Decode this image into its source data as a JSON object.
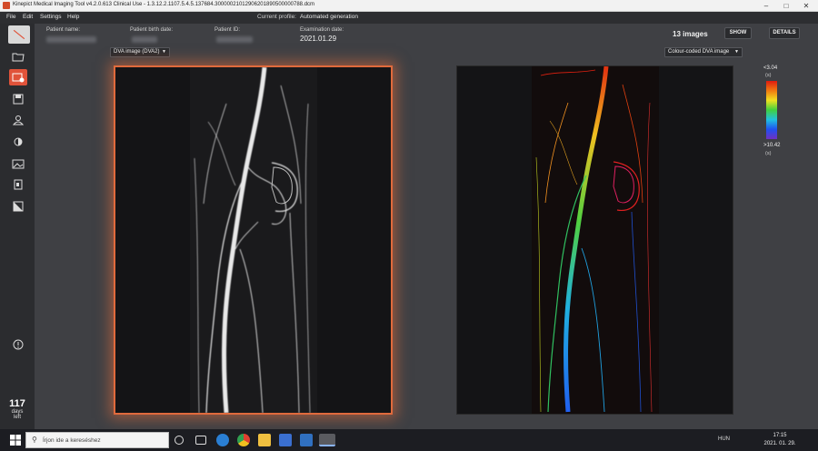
{
  "window": {
    "title": "Kinepict Medical Imaging Tool v4.2.0.613 Clinical Use - 1.3.12.2.1107.5.4.5.137684.30000021012906201890500000788.dcm",
    "minimize": "–",
    "maximize": "□",
    "close": "✕"
  },
  "menu": {
    "items": [
      "File",
      "Edit",
      "Settings",
      "Help"
    ],
    "profile_label": "Current profile:",
    "profile_value": "Automated generation"
  },
  "patient": {
    "name_label": "Patient name:",
    "birth_label": "Patient birth date:",
    "id_label": "Patient ID:",
    "exam_label": "Examination date:",
    "exam_value": "2021.01.29"
  },
  "header": {
    "images_count": "13 images",
    "show_button": "SHOW",
    "details_button": "DETAILS"
  },
  "left_view": {
    "dropdown": "DVA image (DVA2)"
  },
  "right_view": {
    "dropdown": "Colour-coded DVA image"
  },
  "scale": {
    "top_value": "<3.04",
    "top_unit": "(s)",
    "bottom_value": ">10.42",
    "bottom_unit": "(s)"
  },
  "license": {
    "days": "117",
    "days_label": "days",
    "left_label": "left"
  },
  "sidebar": {
    "icons": [
      "logo-icon",
      "open-folder-icon",
      "image-edit-icon",
      "save-icon",
      "user-icon",
      "brightness-icon",
      "gallery-icon",
      "report-icon",
      "contrast-icon",
      "alert-icon"
    ]
  },
  "taskbar": {
    "search_placeholder": "Írjon ide a kereséshez",
    "tray_lang": "HUN",
    "clock_time": "17:15",
    "clock_date": "2021. 01. 29."
  },
  "colors": {
    "accent": "#e0533a",
    "panel_glow": "#e06a3c",
    "background": "#3f4044"
  }
}
